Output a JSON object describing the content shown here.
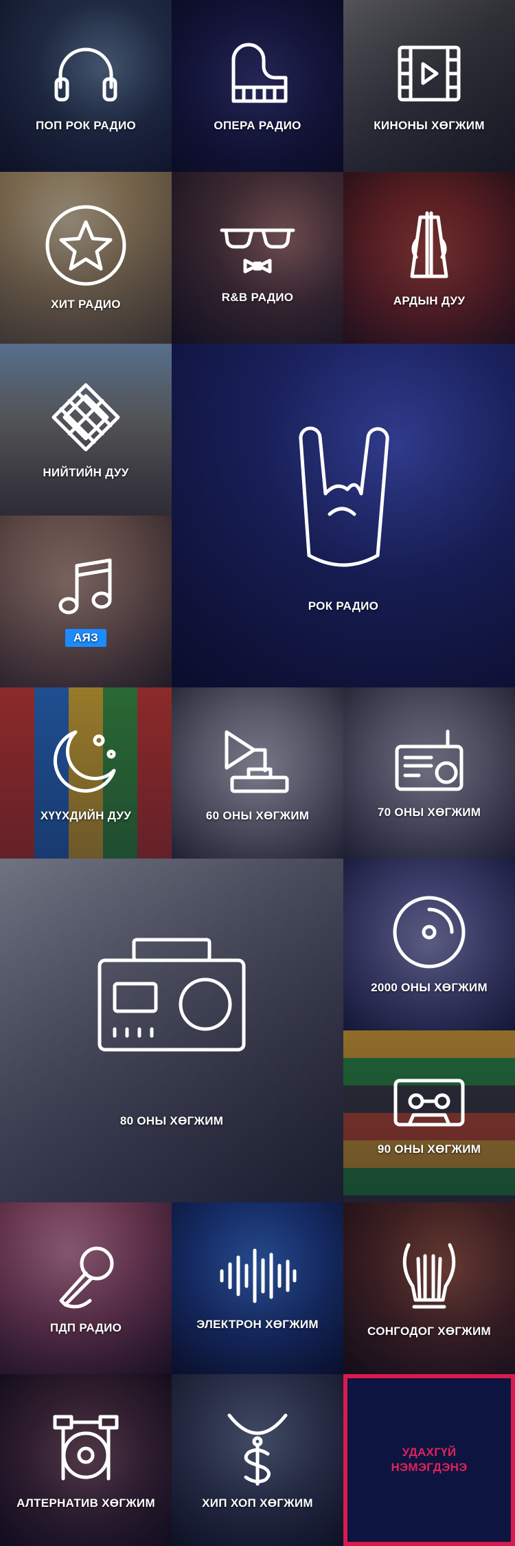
{
  "tiles": {
    "pop_rock": {
      "label": "ПОП РОК РАДИО",
      "icon": "headphones-icon"
    },
    "opera": {
      "label": "ОПЕРА РАДИО",
      "icon": "piano-icon"
    },
    "movie": {
      "label": "КИНОНЫ ХӨГЖИМ",
      "icon": "film-play-icon"
    },
    "hit": {
      "label": "ХИТ РАДИО",
      "icon": "star-icon"
    },
    "rnb": {
      "label": "R&B РАДИО",
      "icon": "sunglasses-bowtie-icon"
    },
    "folk": {
      "label": "АРДЫН ДУУ",
      "icon": "morin-khuur-icon"
    },
    "public_song": {
      "label": "НИЙТИЙН ДУУ",
      "icon": "endless-knot-icon"
    },
    "rock": {
      "label": "РОК РАДИО",
      "icon": "rock-hand-icon"
    },
    "ayaz": {
      "label": "АЯЗ",
      "icon": "music-note-icon"
    },
    "kids": {
      "label": "ХҮҮХДИЙН ДУУ",
      "icon": "moon-stars-icon"
    },
    "sixties": {
      "label": "60 ОНЫ ХӨГЖИМ",
      "icon": "gramophone-icon"
    },
    "seventies": {
      "label": "70 ОНЫ ХӨГЖИМ",
      "icon": "radio-icon"
    },
    "eighties": {
      "label": "80 ОНЫ ХӨГЖИМ",
      "icon": "boombox-icon"
    },
    "twothousands": {
      "label": "2000 ОНЫ ХӨГЖИМ",
      "icon": "cd-icon"
    },
    "nineties": {
      "label": "90 ОНЫ ХӨГЖИМ",
      "icon": "cassette-icon"
    },
    "pdp": {
      "label": "ПДП РАДИО",
      "icon": "microphone-icon"
    },
    "electron": {
      "label": "ЭЛЕКТРОН ХӨГЖИМ",
      "icon": "soundwave-icon"
    },
    "classical": {
      "label": "СОНГОДОГ ХӨГЖИМ",
      "icon": "lyre-icon"
    },
    "alternative": {
      "label": "АЛТЕРНАТИВ ХӨГЖИМ",
      "icon": "drum-kit-icon"
    },
    "hiphop": {
      "label": "ХИП ХОП ХӨГЖИМ",
      "icon": "dollar-chain-icon"
    },
    "coming_soon": {
      "line1": "УДАХГҮЙ",
      "line2": "НЭМЭГДЭНЭ"
    }
  },
  "colors": {
    "accent_red": "#e5254f",
    "badge_blue": "#1a8cff",
    "soon_bg": "#0d1440"
  }
}
